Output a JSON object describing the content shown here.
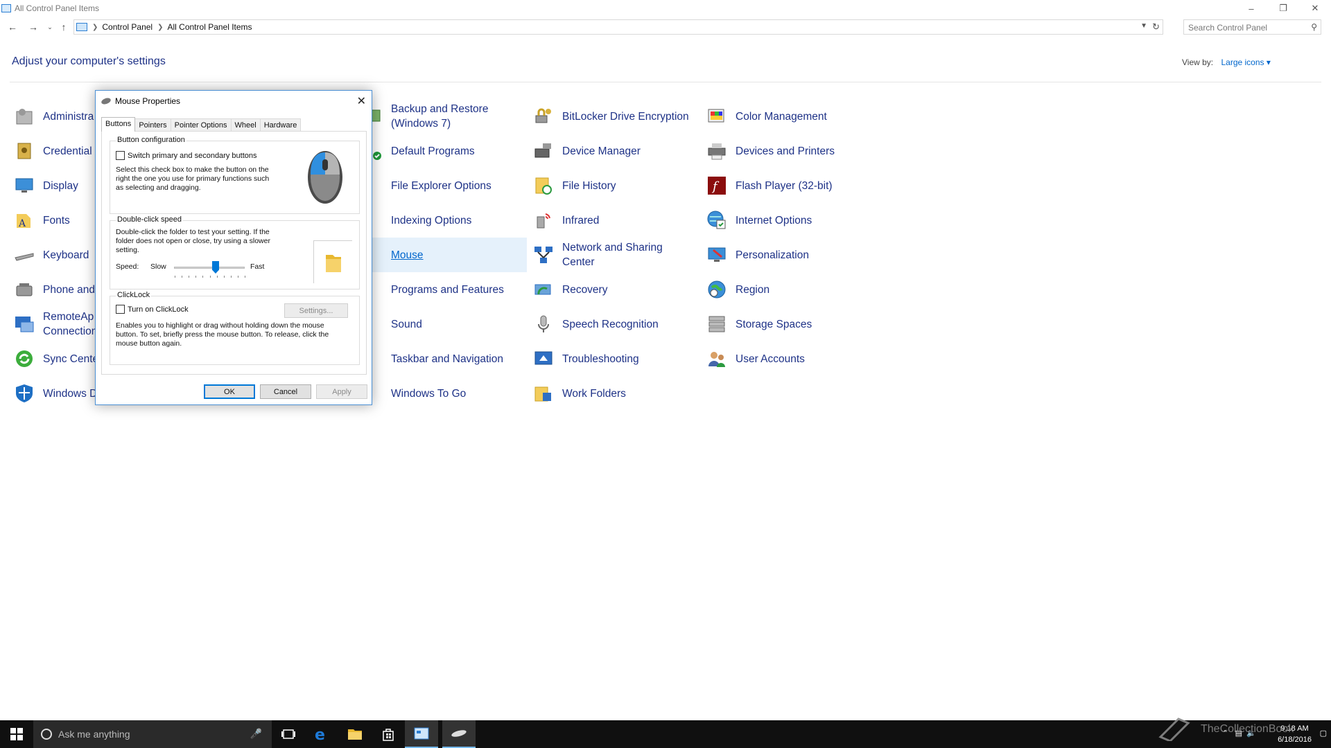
{
  "window": {
    "title": "All Control Panel Items"
  },
  "address": {
    "crumbs": [
      "Control Panel",
      "All Control Panel Items"
    ],
    "search_placeholder": "Search Control Panel"
  },
  "header": {
    "title": "Adjust your computer's settings",
    "view_by_label": "View by:",
    "view_by_value": "Large icons"
  },
  "items": {
    "col1": [
      {
        "label": "Administra",
        "icon": "administrative-tools-icon"
      },
      {
        "label": "Credential",
        "icon": "credential-manager-icon"
      },
      {
        "label": "Display",
        "icon": "display-icon"
      },
      {
        "label": "Fonts",
        "icon": "fonts-icon"
      },
      {
        "label": "Keyboard",
        "icon": "keyboard-icon"
      },
      {
        "label": "Phone and",
        "icon": "phone-modem-icon"
      },
      {
        "label": "RemoteAp Connection",
        "icon": "remoteapp-icon"
      },
      {
        "label": "Sync Cente",
        "icon": "sync-center-icon"
      },
      {
        "label": "Windows D",
        "icon": "windows-defender-icon"
      }
    ],
    "col2": [
      {
        "label": "Backup and Restore (Windows 7)",
        "icon": "backup-restore-icon"
      },
      {
        "label": "Default Programs",
        "icon": "default-programs-icon"
      },
      {
        "label": "File Explorer Options",
        "icon": "file-explorer-options-icon"
      },
      {
        "label": "Indexing Options",
        "icon": "indexing-options-icon"
      },
      {
        "label": "Mouse",
        "icon": "mouse-icon"
      },
      {
        "label": "Programs and Features",
        "icon": "programs-features-icon"
      },
      {
        "label": "Sound",
        "icon": "sound-icon"
      },
      {
        "label": "Taskbar and Navigation",
        "icon": "taskbar-icon"
      },
      {
        "label": "Windows To Go",
        "icon": "windows-to-go-icon"
      }
    ],
    "col3": [
      {
        "label": "BitLocker Drive Encryption",
        "icon": "bitlocker-icon"
      },
      {
        "label": "Device Manager",
        "icon": "device-manager-icon"
      },
      {
        "label": "File History",
        "icon": "file-history-icon"
      },
      {
        "label": "Infrared",
        "icon": "infrared-icon"
      },
      {
        "label": "Network and Sharing Center",
        "icon": "network-sharing-icon"
      },
      {
        "label": "Recovery",
        "icon": "recovery-icon"
      },
      {
        "label": "Speech Recognition",
        "icon": "microphone-icon"
      },
      {
        "label": "Troubleshooting",
        "icon": "troubleshooting-icon"
      },
      {
        "label": "Work Folders",
        "icon": "work-folders-icon"
      }
    ],
    "col4": [
      {
        "label": "Color Management",
        "icon": "color-management-icon"
      },
      {
        "label": "Devices and Printers",
        "icon": "printer-icon"
      },
      {
        "label": "Flash Player (32-bit)",
        "icon": "flash-player-icon"
      },
      {
        "label": "Internet Options",
        "icon": "internet-options-icon"
      },
      {
        "label": "Personalization",
        "icon": "personalization-icon"
      },
      {
        "label": "Region",
        "icon": "region-icon"
      },
      {
        "label": "Storage Spaces",
        "icon": "storage-spaces-icon"
      },
      {
        "label": "User Accounts",
        "icon": "user-accounts-icon"
      }
    ]
  },
  "dialog": {
    "title": "Mouse Properties",
    "tabs": [
      "Buttons",
      "Pointers",
      "Pointer Options",
      "Wheel",
      "Hardware"
    ],
    "button_config": {
      "title": "Button configuration",
      "checkbox": "Switch primary and secondary buttons",
      "checked": false,
      "description": "Select this check box to make the button on the right the one you use for primary functions such as selecting and dragging."
    },
    "double_click": {
      "title": "Double-click speed",
      "description": "Double-click the folder to test your setting. If the folder does not open or close, try using a slower setting.",
      "speed_label": "Speed:",
      "slow": "Slow",
      "fast": "Fast",
      "value": 0.6
    },
    "clicklock": {
      "title": "ClickLock",
      "checkbox": "Turn on ClickLock",
      "checked": false,
      "settings_button": "Settings...",
      "description": "Enables you to highlight or drag without holding down the mouse button. To set, briefly press the mouse button. To release, click the mouse button again."
    },
    "buttons": {
      "ok": "OK",
      "cancel": "Cancel",
      "apply": "Apply"
    }
  },
  "taskbar": {
    "search_placeholder": "Ask me anything",
    "time": "9:18 AM",
    "date": "6/18/2016"
  },
  "watermark": "TheCollectionBook",
  "colors": {
    "link": "#1e3287",
    "accent": "#0078d7",
    "taskbar": "#101010"
  }
}
